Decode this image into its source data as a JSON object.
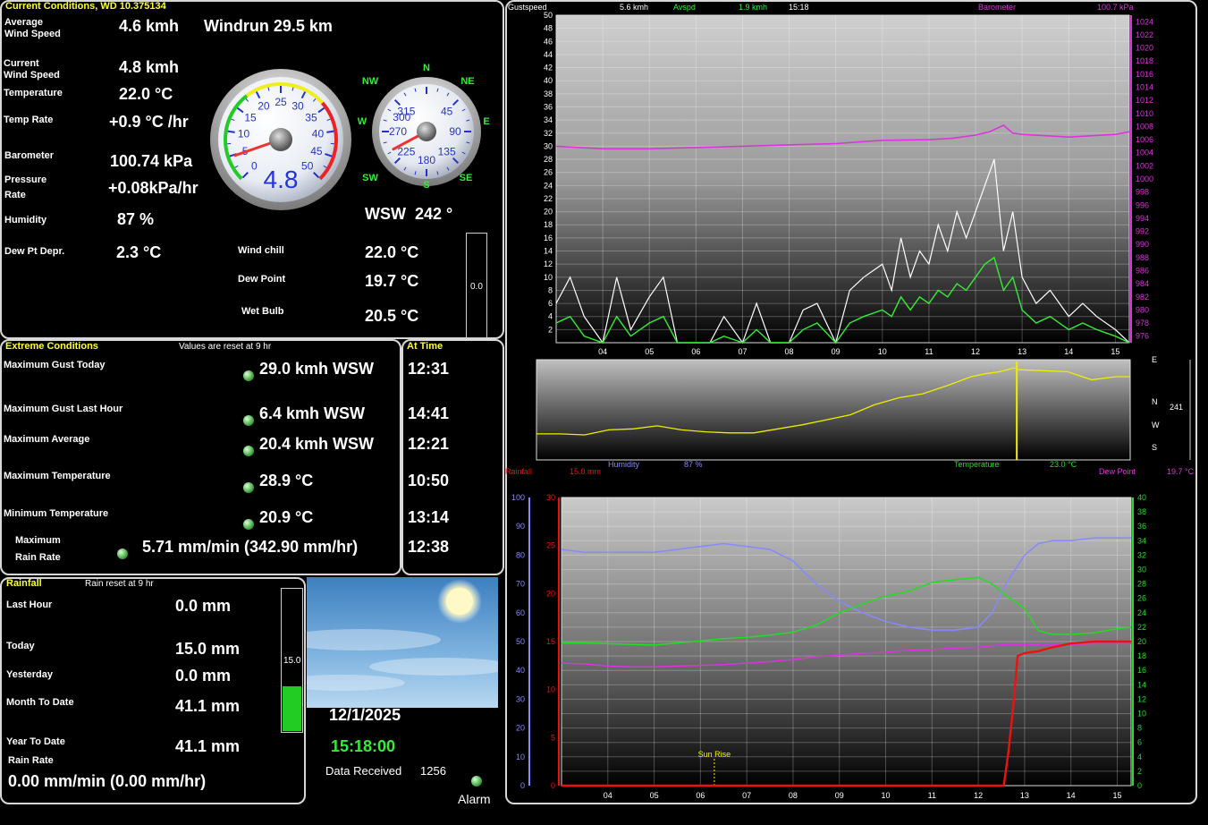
{
  "current": {
    "title": "Current Conditions, WD 10.375134",
    "avg_wind_label": "Average\nWind Speed",
    "avg_wind_value": "4.6 kmh",
    "windrun": "Windrun 29.5 km",
    "cur_wind_label": "Current\nWind Speed",
    "cur_wind_value": "4.8 kmh",
    "temperature_label": "Temperature",
    "temperature_value": "22.0 °C",
    "temp_rate_label": "Temp Rate",
    "temp_rate_value": "+0.9 °C /hr",
    "barometer_label": "Barometer",
    "barometer_value": "100.74 kPa",
    "pressure_rate_label": "Pressure\nRate",
    "pressure_rate_value": "+0.08kPa/hr",
    "humidity_label": "Humidity",
    "humidity_value": "87 %",
    "dewpt_depr_label": "Dew Pt Depr.",
    "dewpt_depr_value": "2.3 °C",
    "wind_chill_label": "Wind chill",
    "wind_chill_value": "22.0 °C",
    "dew_point_label": "Dew Point",
    "dew_point_value": "19.7 °C",
    "wet_bulb_label": "Wet Bulb",
    "wet_bulb_value": "20.5 °C",
    "direction_text": "WSW  242 °",
    "direction_degrees": 242,
    "bar_value": "0.0",
    "speed_gauge": {
      "value_text": "4.8",
      "value": 4.8,
      "ticks": [
        "0",
        "5",
        "10",
        "15",
        "20",
        "25",
        "30",
        "35",
        "40",
        "45",
        "50"
      ]
    },
    "compass": {
      "points": [
        "N",
        "NE",
        "E",
        "SE",
        "S",
        "SW",
        "W",
        "NW"
      ],
      "degree_labels": [
        "300",
        "315",
        "45",
        "90",
        "135",
        "180",
        "225",
        "270"
      ]
    }
  },
  "extremes": {
    "title": "Extreme Conditions",
    "reset_note": "Values are reset at 9 hr",
    "time_header": "At Time",
    "rows": [
      {
        "label": "Maximum Gust Today",
        "value": "29.0 kmh WSW",
        "time": "12:31"
      },
      {
        "label": "Maximum Gust Last Hour",
        "value": "6.4 kmh WSW",
        "time": "14:41"
      },
      {
        "label": "Maximum Average",
        "value": "20.4 kmh WSW",
        "time": "12:21"
      },
      {
        "label": "Maximum Temperature",
        "value": "28.9 °C",
        "time": "10:50"
      },
      {
        "label": "Minimum Temperature",
        "value": "20.9 °C",
        "time": "13:14"
      },
      {
        "label": "Maximum\nRain Rate",
        "value": "5.71 mm/min (342.90 mm/hr)",
        "time": "12:38"
      }
    ]
  },
  "rainfall": {
    "title": "Rainfall",
    "reset_note": "Rain reset at 9 hr",
    "rows": [
      {
        "label": "Last Hour",
        "value": "0.0 mm"
      },
      {
        "label": "Today",
        "value": "15.0 mm"
      },
      {
        "label": "Yesterday",
        "value": "0.0 mm"
      },
      {
        "label": "Month To Date",
        "value": "41.1 mm"
      },
      {
        "label": "Year To Date",
        "value": "41.1 mm"
      }
    ],
    "rain_rate_label": "Rain Rate",
    "rain_rate_value": "0.00 mm/min (0.00 mm/hr)",
    "bar_value": "15.0",
    "bar_fill_fraction": 0.31
  },
  "status": {
    "date": "12/1/2025",
    "time": "15:18:00",
    "data_received_label": "Data Received",
    "data_received_value": "1256",
    "alarm_label": "Alarm"
  },
  "colors": {
    "title_yellow": "#ffff33",
    "gust_white": "#ffffff",
    "avg_green": "#33ee33",
    "barometer_magenta": "#dd33dd",
    "direction_yellow": "#eeee00",
    "humidity_blue": "#8888ff",
    "temperature_green": "#22dd22",
    "dewpoint_magenta": "#dd33dd",
    "rain_red": "#ee1111"
  },
  "chart_data": [
    {
      "type": "line",
      "legend": [
        {
          "name": "Gustspeed",
          "value": "5.6 kmh"
        },
        {
          "name": "Avspd",
          "value": "1.9 kmh"
        },
        {
          "name": "15:18",
          "value": ""
        },
        {
          "name": "Barometer",
          "value": "100.7 kPa"
        }
      ],
      "categories": [
        "04",
        "05",
        "06",
        "07",
        "08",
        "09",
        "10",
        "11",
        "12",
        "13",
        "14",
        "15"
      ],
      "left_axis": {
        "ylim": [
          0,
          50
        ],
        "ticks": [
          2,
          4,
          6,
          8,
          10,
          12,
          14,
          16,
          18,
          20,
          22,
          24,
          26,
          28,
          30,
          32,
          34,
          36,
          38,
          40,
          42,
          44,
          46,
          48,
          50
        ]
      },
      "right_axis": {
        "ylim": [
          975,
          1025
        ],
        "ticks": [
          976,
          978,
          980,
          982,
          984,
          986,
          988,
          990,
          992,
          994,
          996,
          998,
          1000,
          1002,
          1004,
          1006,
          1008,
          1010,
          1012,
          1014,
          1016,
          1018,
          1020,
          1022,
          1024
        ]
      },
      "series": [
        {
          "name": "Gustspeed",
          "axis": "left",
          "x": [
            3.0,
            3.3,
            3.6,
            4.0,
            4.3,
            4.6,
            5.0,
            5.3,
            5.6,
            6.0,
            6.3,
            6.6,
            7.0,
            7.3,
            7.6,
            8.0,
            8.3,
            8.6,
            9.0,
            9.3,
            9.6,
            10.0,
            10.2,
            10.4,
            10.6,
            10.8,
            11.0,
            11.2,
            11.4,
            11.6,
            11.8,
            12.0,
            12.2,
            12.4,
            12.6,
            12.8,
            13.0,
            13.3,
            13.6,
            14.0,
            14.3,
            14.6,
            15.0,
            15.3
          ],
          "values": [
            6,
            10,
            4,
            0,
            10,
            2,
            7,
            10,
            0,
            0,
            0,
            4,
            0,
            6,
            0,
            0,
            5,
            6,
            0,
            8,
            10,
            12,
            8,
            16,
            10,
            14,
            12,
            18,
            14,
            20,
            16,
            20,
            24,
            28,
            14,
            20,
            10,
            6,
            8,
            4,
            6,
            4,
            2,
            0
          ]
        },
        {
          "name": "Avspd",
          "axis": "left",
          "x": [
            3.0,
            3.3,
            3.6,
            4.0,
            4.3,
            4.6,
            5.0,
            5.3,
            5.6,
            6.0,
            6.3,
            6.6,
            7.0,
            7.3,
            7.6,
            8.0,
            8.3,
            8.6,
            9.0,
            9.3,
            9.6,
            10.0,
            10.2,
            10.4,
            10.6,
            10.8,
            11.0,
            11.2,
            11.4,
            11.6,
            11.8,
            12.0,
            12.2,
            12.4,
            12.6,
            12.8,
            13.0,
            13.3,
            13.6,
            14.0,
            14.3,
            14.6,
            15.0,
            15.3
          ],
          "values": [
            3,
            4,
            1,
            0,
            4,
            1,
            3,
            4,
            0,
            0,
            0,
            1,
            0,
            2,
            0,
            0,
            2,
            3,
            0,
            3,
            4,
            5,
            4,
            7,
            5,
            7,
            6,
            8,
            7,
            9,
            8,
            10,
            12,
            13,
            8,
            10,
            5,
            3,
            4,
            2,
            3,
            2,
            1,
            0
          ]
        },
        {
          "name": "Barometer",
          "axis": "right",
          "x": [
            3.0,
            4.0,
            5.0,
            6.0,
            7.0,
            8.0,
            9.0,
            10.0,
            11.0,
            11.5,
            12.0,
            12.3,
            12.6,
            12.8,
            13.0,
            13.5,
            14.0,
            14.5,
            15.0,
            15.3
          ],
          "values": [
            1005.0,
            1004.6,
            1004.6,
            1004.8,
            1005.0,
            1005.2,
            1005.4,
            1005.9,
            1006.0,
            1006.2,
            1006.7,
            1007.2,
            1008.2,
            1007.0,
            1006.8,
            1006.6,
            1006.4,
            1006.6,
            1006.8,
            1007.2
          ]
        }
      ]
    },
    {
      "type": "line",
      "right_labels": [
        "E",
        "N",
        "W",
        "S"
      ],
      "right_value": "241",
      "series": [
        {
          "name": "Wind direction",
          "x": [
            3.0,
            3.5,
            4.0,
            4.5,
            5.0,
            5.5,
            6.0,
            6.5,
            7.0,
            7.5,
            8.0,
            8.5,
            9.0,
            9.5,
            10.0,
            10.5,
            11.0,
            11.5,
            12.0,
            12.3,
            12.6,
            12.9,
            13.0,
            13.5,
            14.0,
            14.5,
            15.0,
            15.3
          ],
          "values": [
            0.26,
            0.26,
            0.25,
            0.3,
            0.31,
            0.34,
            0.3,
            0.28,
            0.27,
            0.27,
            0.31,
            0.35,
            0.4,
            0.45,
            0.55,
            0.62,
            0.66,
            0.74,
            0.83,
            0.86,
            0.88,
            0.92,
            0.9,
            0.89,
            0.88,
            0.8,
            0.83,
            0.83
          ]
        }
      ]
    },
    {
      "type": "line",
      "legend": [
        {
          "name": "Rainfall",
          "value": "15.0 mm"
        },
        {
          "name": "Humidity",
          "value": "87 %"
        },
        {
          "name": "Temperature",
          "value": "23.0 °C"
        },
        {
          "name": "Dew Point",
          "value": "19.7 °C"
        }
      ],
      "categories": [
        "04",
        "05",
        "06",
        "07",
        "08",
        "09",
        "10",
        "11",
        "12",
        "13",
        "14",
        "15"
      ],
      "annotation": "Sun Rise",
      "annotation_x": 6.3,
      "humidity_axis": {
        "ylim": [
          0,
          100
        ],
        "ticks": [
          0,
          10,
          20,
          30,
          40,
          50,
          60,
          70,
          80,
          90,
          100
        ]
      },
      "rain_axis": {
        "ylim": [
          0,
          30
        ],
        "ticks": [
          0,
          5,
          10,
          15,
          20,
          25,
          30
        ]
      },
      "temp_axis": {
        "ylim": [
          0,
          40
        ],
        "ticks": [
          0,
          2,
          4,
          6,
          8,
          10,
          12,
          14,
          16,
          18,
          20,
          22,
          24,
          26,
          28,
          30,
          32,
          34,
          36,
          38,
          40
        ]
      },
      "series": [
        {
          "name": "Humidity",
          "axis": "humidity",
          "x": [
            3.0,
            3.5,
            4.0,
            4.5,
            5.0,
            5.5,
            6.0,
            6.5,
            7.0,
            7.5,
            8.0,
            8.5,
            9.0,
            9.5,
            10.0,
            10.5,
            11.0,
            11.5,
            12.0,
            12.3,
            12.6,
            13.0,
            13.3,
            13.6,
            14.0,
            14.5,
            15.0,
            15.3
          ],
          "values": [
            82,
            81,
            81,
            81,
            81,
            82,
            83,
            84,
            83,
            82,
            78,
            70,
            64,
            60,
            57,
            55,
            54,
            54,
            55,
            60,
            70,
            80,
            84,
            85,
            85,
            86,
            86,
            86
          ]
        },
        {
          "name": "Temperature",
          "axis": "temp",
          "x": [
            3.0,
            3.5,
            4.0,
            4.5,
            5.0,
            5.5,
            6.0,
            6.5,
            7.0,
            7.5,
            8.0,
            8.5,
            9.0,
            9.5,
            10.0,
            10.5,
            11.0,
            11.5,
            12.0,
            12.3,
            12.6,
            13.0,
            13.3,
            13.6,
            14.0,
            14.5,
            15.0,
            15.3
          ],
          "values": [
            19.8,
            19.8,
            19.7,
            19.6,
            19.5,
            19.8,
            20.1,
            20.4,
            20.6,
            20.9,
            21.3,
            22.3,
            24.0,
            25.2,
            26.3,
            27.0,
            28.2,
            28.6,
            28.9,
            28.0,
            26.4,
            24.6,
            21.5,
            21.0,
            21.0,
            21.2,
            21.8,
            22.0
          ]
        },
        {
          "name": "Dew Point",
          "axis": "temp",
          "x": [
            3.0,
            3.5,
            4.0,
            4.5,
            5.0,
            5.5,
            6.0,
            6.5,
            7.0,
            7.5,
            8.0,
            8.5,
            9.0,
            9.5,
            10.0,
            10.5,
            11.0,
            11.5,
            12.0,
            12.3,
            12.6,
            13.0,
            13.5,
            14.0,
            14.5,
            15.0,
            15.3
          ],
          "values": [
            17.0,
            16.9,
            16.6,
            16.5,
            16.5,
            16.6,
            16.7,
            16.8,
            17.0,
            17.2,
            17.5,
            17.9,
            18.1,
            18.4,
            18.5,
            18.8,
            18.9,
            19.1,
            19.2,
            19.4,
            19.6,
            19.6,
            19.6,
            19.6,
            19.7,
            19.7,
            19.7
          ]
        },
        {
          "name": "Rainfall",
          "axis": "rain",
          "x": [
            3.0,
            4.0,
            6.0,
            8.0,
            10.0,
            12.0,
            12.55,
            12.65,
            12.75,
            12.85,
            13.0,
            13.3,
            13.6,
            14.0,
            14.5,
            15.0,
            15.3
          ],
          "values": [
            0,
            0,
            0,
            0,
            0,
            0,
            0,
            3.5,
            8.0,
            13.5,
            13.8,
            14.0,
            14.4,
            14.8,
            15.0,
            15.0,
            15.0
          ]
        }
      ]
    }
  ]
}
